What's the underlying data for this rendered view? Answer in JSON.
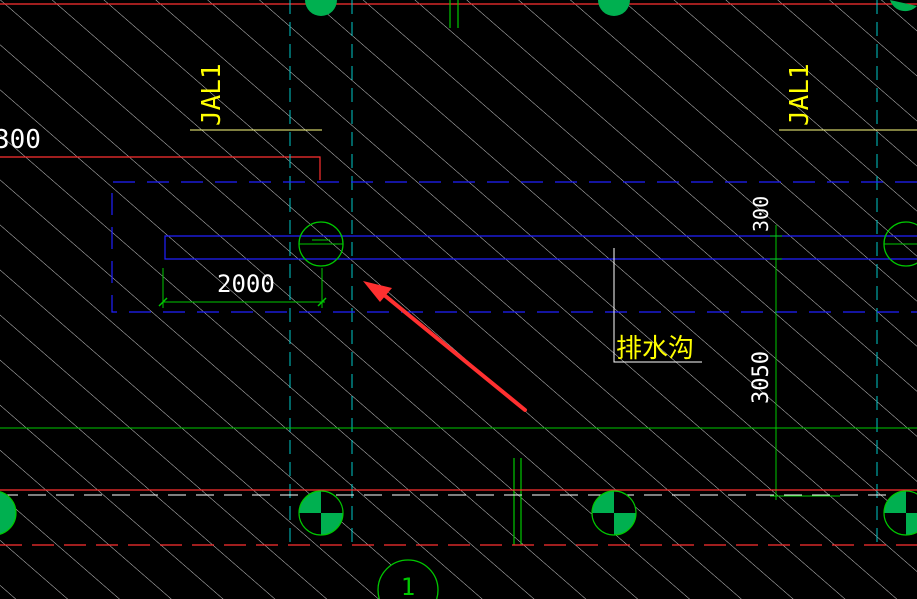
{
  "drawing": {
    "labels": {
      "beam_left": "JAL1",
      "beam_right": "JAL1",
      "dim_left_partial": "300",
      "dim_width": "2000",
      "dim_top_right": "300",
      "dim_vertical": "3050",
      "trench_label": "排水沟",
      "axis_bubble": "1"
    },
    "colors": {
      "background": "#000000",
      "hatch": "#c8c8c8",
      "red_line": "#ff3030",
      "yellow_text": "#ffff00",
      "blue_line": "#2020ff",
      "green_line": "#00c800",
      "cyan_dash": "#00c8c8",
      "white_line": "#ffffff",
      "arrow": "#ff3030",
      "column_fill": "#00b050",
      "column_dark": "#000000"
    }
  }
}
